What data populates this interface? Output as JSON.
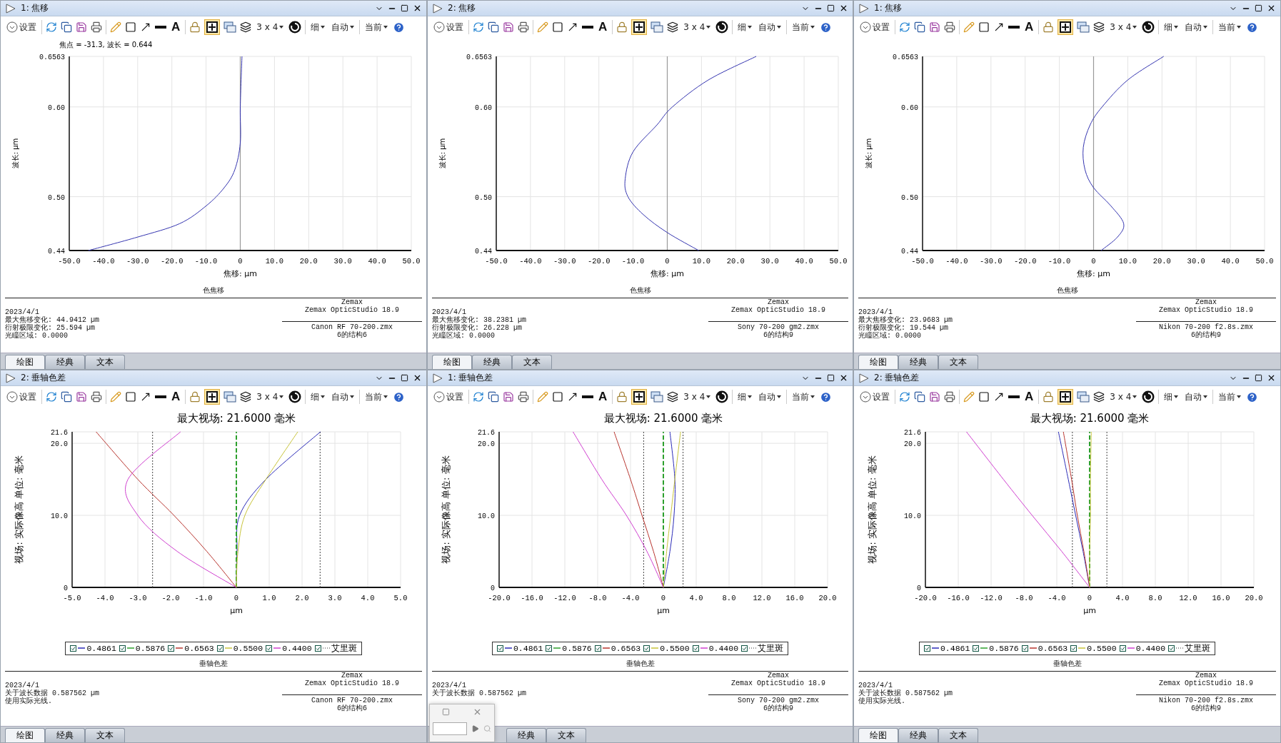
{
  "panels": [
    {
      "kind": "focal_shift",
      "title": "1: 焦移",
      "toolbar": {
        "settings": "设置",
        "text_tool": "A",
        "grid": "3 x 4",
        "line_width": "细",
        "scale": "自动",
        "config": "当前",
        "tile_view_on": true
      },
      "chart_data": {
        "type": "line",
        "orientation": "horizontal",
        "xlabel": "焦移: µm",
        "ylabel": "波长: µm",
        "x": [
          0.44,
          0.455,
          0.47,
          0.49,
          0.51,
          0.53,
          0.56,
          0.6,
          0.6563
        ],
        "grid": true,
        "series": [
          {
            "color": "#3434b0",
            "values": [
              -44.4,
              -30,
              -17.7,
              -9.9,
              -4.7,
              -1.6,
              0,
              0,
              0.5
            ]
          }
        ],
        "xlim": [
          -50,
          50
        ],
        "ylim": [
          0.44,
          0.6563
        ],
        "xticks": [
          {
            "value": -50,
            "label": "-50.0"
          },
          {
            "value": -40,
            "label": "-40.0"
          },
          {
            "value": -30,
            "label": "-30.0"
          },
          {
            "value": -20,
            "label": "-20.0"
          },
          {
            "value": -10,
            "label": "-10.0"
          },
          {
            "value": 0,
            "label": "0"
          },
          {
            "value": 10,
            "label": "10.0"
          },
          {
            "value": 20,
            "label": "20.0"
          },
          {
            "value": 30,
            "label": "30.0"
          },
          {
            "value": 40,
            "label": "40.0"
          },
          {
            "value": 50,
            "label": "50.0"
          }
        ],
        "yticks": [
          {
            "value": 0.44,
            "label": "0.44"
          },
          {
            "value": 0.5,
            "label": "0.50"
          },
          {
            "value": 0.6,
            "label": "0.60"
          },
          {
            "value": 0.6563,
            "label": "0.6563"
          }
        ],
        "annotations": [
          {
            "text": "焦点 = -31.3, 波长 = 0.644"
          }
        ]
      },
      "footer": {
        "title": "色焦移",
        "info": [
          "2023/4/1",
          "最大焦移变化: 44.9412 µm",
          "衍射极限变化: 25.594 µm",
          "光瞳区域: 0.0000"
        ],
        "vendor": "Zemax",
        "version": "Zemax OpticStudio 18.9",
        "file": "Canon RF 70-200.zmx",
        "config": "6的结构6"
      },
      "tabs": [
        {
          "label": "绘图",
          "selected": true
        },
        {
          "label": "经典",
          "selected": false
        },
        {
          "label": "文本",
          "selected": false
        }
      ]
    },
    {
      "kind": "focal_shift",
      "title": "2: 焦移",
      "toolbar": {
        "settings": "设置",
        "text_tool": "A",
        "grid": "3 x 4",
        "line_width": "细",
        "scale": "自动",
        "config": "当前",
        "tile_view_on": true
      },
      "chart_data": {
        "type": "line",
        "orientation": "horizontal",
        "xlabel": "焦移: µm",
        "ylabel": "波长: µm",
        "x": [
          0.44,
          0.46,
          0.48,
          0.5,
          0.52,
          0.55,
          0.58,
          0.6,
          0.63,
          0.6563
        ],
        "grid": true,
        "series": [
          {
            "color": "#3434b0",
            "values": [
              9.2,
              0,
              -7,
              -11.5,
              -12.3,
              -10,
              -3,
              1.5,
              12,
              26
            ]
          }
        ],
        "xlim": [
          -50,
          50
        ],
        "ylim": [
          0.44,
          0.6563
        ],
        "xticks": [
          {
            "value": -50,
            "label": "-50.0"
          },
          {
            "value": -40,
            "label": "-40.0"
          },
          {
            "value": -30,
            "label": "-30.0"
          },
          {
            "value": -20,
            "label": "-20.0"
          },
          {
            "value": -10,
            "label": "-10.0"
          },
          {
            "value": 0,
            "label": "0"
          },
          {
            "value": 10,
            "label": "10.0"
          },
          {
            "value": 20,
            "label": "20.0"
          },
          {
            "value": 30,
            "label": "30.0"
          },
          {
            "value": 40,
            "label": "40.0"
          },
          {
            "value": 50,
            "label": "50.0"
          }
        ],
        "yticks": [
          {
            "value": 0.44,
            "label": "0.44"
          },
          {
            "value": 0.5,
            "label": "0.50"
          },
          {
            "value": 0.6,
            "label": "0.60"
          },
          {
            "value": 0.6563,
            "label": "0.6563"
          }
        ]
      },
      "footer": {
        "title": "色焦移",
        "info": [
          "2023/4/1",
          "最大焦移变化: 38.2381 µm",
          "衍射极限变化: 26.228 µm",
          "光瞳区域: 0.0000"
        ],
        "vendor": "Zemax",
        "version": "Zemax OpticStudio 18.9",
        "file": "Sony 70-200 gm2.zmx",
        "config": "6的结构9"
      },
      "tabs": [
        {
          "label": "绘图",
          "selected": true
        },
        {
          "label": "经典",
          "selected": false
        },
        {
          "label": "文本",
          "selected": false
        }
      ]
    },
    {
      "kind": "focal_shift",
      "title": "1: 焦移",
      "toolbar": {
        "settings": "设置",
        "text_tool": "A",
        "grid": "3 x 4",
        "line_width": "细",
        "scale": "自动",
        "config": "当前",
        "tile_view_on": true
      },
      "chart_data": {
        "type": "line",
        "orientation": "horizontal",
        "xlabel": "焦移: µm",
        "ylabel": "波长: µm",
        "x": [
          0.44,
          0.455,
          0.47,
          0.49,
          0.51,
          0.53,
          0.555,
          0.58,
          0.6,
          0.63,
          0.6563
        ],
        "grid": true,
        "series": [
          {
            "color": "#3434b0",
            "values": [
              2.2,
              7,
              8.8,
              5,
              0,
              -2.5,
              -3,
              -1,
              2.5,
              10,
              20.5
            ]
          }
        ],
        "xlim": [
          -50,
          50
        ],
        "ylim": [
          0.44,
          0.6563
        ],
        "xticks": [
          {
            "value": -50,
            "label": "-50.0"
          },
          {
            "value": -40,
            "label": "-40.0"
          },
          {
            "value": -30,
            "label": "-30.0"
          },
          {
            "value": -20,
            "label": "-20.0"
          },
          {
            "value": -10,
            "label": "-10.0"
          },
          {
            "value": 0,
            "label": "0"
          },
          {
            "value": 10,
            "label": "10.0"
          },
          {
            "value": 20,
            "label": "20.0"
          },
          {
            "value": 30,
            "label": "30.0"
          },
          {
            "value": 40,
            "label": "40.0"
          },
          {
            "value": 50,
            "label": "50.0"
          }
        ],
        "yticks": [
          {
            "value": 0.44,
            "label": "0.44"
          },
          {
            "value": 0.5,
            "label": "0.50"
          },
          {
            "value": 0.6,
            "label": "0.60"
          },
          {
            "value": 0.6563,
            "label": "0.6563"
          }
        ]
      },
      "footer": {
        "title": "色焦移",
        "info": [
          "2023/4/1",
          "最大焦移变化: 23.9683 µm",
          "衍射极限变化: 19.544 µm",
          "光瞳区域: 0.0000"
        ],
        "vendor": "Zemax",
        "version": "Zemax OpticStudio 18.9",
        "file": "Nikon 70-200 f2.8s.zmx",
        "config": "6的结构9"
      },
      "tabs": [
        {
          "label": "绘图",
          "selected": true
        },
        {
          "label": "经典",
          "selected": false
        },
        {
          "label": "文本",
          "selected": false
        }
      ]
    },
    {
      "kind": "lateral_color",
      "title": "2: 垂轴色差",
      "toolbar": {
        "settings": "设置",
        "text_tool": "A",
        "grid": "3 x 4",
        "line_width": "细",
        "scale": "自动",
        "config": "当前",
        "tile_view_on": true
      },
      "chart_data": {
        "type": "line",
        "orientation": "horizontal",
        "title": "最大视场: 21.6000 毫米",
        "xlabel": "µm",
        "ylabel": "视场: 实际像高 单位: 毫米",
        "x": [
          0,
          5,
          10,
          15,
          21.6
        ],
        "grid": true,
        "series": [
          {
            "name": "0.4861",
            "color": "#2b2bb8",
            "values": [
              0,
              0.02,
              0.1,
              0.9,
              2.56
            ]
          },
          {
            "name": "0.5876",
            "color": "#2ca02c",
            "line_style": "dashed",
            "values": [
              0,
              0,
              0,
              0,
              0
            ]
          },
          {
            "name": "0.6563",
            "color": "#b8342e",
            "values": [
              0,
              -0.9,
              -1.9,
              -3,
              -4.27
            ]
          },
          {
            "name": "0.5500",
            "color": "#c8c43a",
            "values": [
              0,
              0.05,
              0.26,
              0.9,
              1.87
            ]
          },
          {
            "name": "0.4400",
            "color": "#d040d0",
            "values": [
              0,
              -1.8,
              -3,
              -3.3,
              -1.7
            ]
          }
        ],
        "xlim": [
          -5,
          5
        ],
        "ylim": [
          0,
          21.6
        ],
        "xticks": [
          {
            "value": -5,
            "label": "-5.0"
          },
          {
            "value": -4,
            "label": "-4.0"
          },
          {
            "value": -3,
            "label": "-3.0"
          },
          {
            "value": -2,
            "label": "-2.0"
          },
          {
            "value": -1,
            "label": "-1.0"
          },
          {
            "value": 0,
            "label": "0"
          },
          {
            "value": 1,
            "label": "1.0"
          },
          {
            "value": 2,
            "label": "2.0"
          },
          {
            "value": 3,
            "label": "3.0"
          },
          {
            "value": 4,
            "label": "4.0"
          },
          {
            "value": 5,
            "label": "5.0"
          }
        ],
        "yticks": [
          {
            "value": 0,
            "label": "0"
          },
          {
            "value": 10,
            "label": "10.0"
          },
          {
            "value": 20,
            "label": "20.0"
          },
          {
            "value": 21.6,
            "label": "21.6"
          }
        ],
        "ref_lines": [
          {
            "axis": "x",
            "value": -2.55,
            "label": "艾里斑"
          },
          {
            "axis": "x",
            "value": 2.55
          }
        ]
      },
      "footer": {
        "title": "垂轴色差",
        "info": [
          "2023/4/1",
          "关于波长数据 0.587562 µm",
          "使用实际光线."
        ],
        "vendor": "Zemax",
        "version": "Zemax OpticStudio 18.9",
        "file": "Canon RF 70-200.zmx",
        "config": "6的结构6"
      },
      "tabs": [
        {
          "label": "绘图",
          "selected": true
        },
        {
          "label": "经典",
          "selected": false
        },
        {
          "label": "文本",
          "selected": false
        }
      ]
    },
    {
      "kind": "lateral_color",
      "title": "1: 垂轴色差",
      "toolbar": {
        "settings": "设置",
        "text_tool": "A",
        "grid": "3 x 4",
        "line_width": "细",
        "scale": "自动",
        "config": "当前",
        "tile_view_on": true
      },
      "chart_data": {
        "type": "line",
        "orientation": "horizontal",
        "title": "最大视场: 21.6000 毫米",
        "xlabel": "µm",
        "ylabel": "视场: 实际像高 单位: 毫米",
        "x": [
          0,
          5,
          10,
          15,
          21.6
        ],
        "grid": true,
        "series": [
          {
            "name": "0.4861",
            "color": "#2b2bb8",
            "values": [
              0,
              0.8,
              1.3,
              1.4,
              0.8
            ]
          },
          {
            "name": "0.5876",
            "color": "#2ca02c",
            "line_style": "dashed",
            "values": [
              0,
              0,
              0,
              0,
              0
            ]
          },
          {
            "name": "0.6563",
            "color": "#b8342e",
            "values": [
              0,
              -1.2,
              -2.6,
              -4,
              -6
            ]
          },
          {
            "name": "0.5500",
            "color": "#c8c43a",
            "values": [
              0,
              0.4,
              0.9,
              1.4,
              2.1
            ]
          },
          {
            "name": "0.4400",
            "color": "#d040d0",
            "values": [
              0,
              -2,
              -4.5,
              -7.5,
              -11
            ]
          }
        ],
        "xlim": [
          -20,
          20
        ],
        "ylim": [
          0,
          21.6
        ],
        "xticks": [
          {
            "value": -20,
            "label": "-20.0"
          },
          {
            "value": -16,
            "label": "-16.0"
          },
          {
            "value": -12,
            "label": "-12.0"
          },
          {
            "value": -8,
            "label": "-8.0"
          },
          {
            "value": -4,
            "label": "-4.0"
          },
          {
            "value": 0,
            "label": "0"
          },
          {
            "value": 4,
            "label": "4.0"
          },
          {
            "value": 8,
            "label": "8.0"
          },
          {
            "value": 12,
            "label": "12.0"
          },
          {
            "value": 16,
            "label": "16.0"
          },
          {
            "value": 20,
            "label": "20.0"
          }
        ],
        "yticks": [
          {
            "value": 0,
            "label": "0"
          },
          {
            "value": 10,
            "label": "10.0"
          },
          {
            "value": 20,
            "label": "20.0"
          },
          {
            "value": 21.6,
            "label": "21.6"
          }
        ],
        "ref_lines": [
          {
            "axis": "x",
            "value": -2.4,
            "label": "艾里斑"
          },
          {
            "axis": "x",
            "value": 2.4
          }
        ]
      },
      "footer": {
        "title": "垂轴色差",
        "info": [
          "2023/4/1",
          "关于波长数据 0.587562 µm"
        ],
        "vendor": "Zemax",
        "version": "Zemax OpticStudio 18.9",
        "file": "Sony 70-200 gm2.zmx",
        "config": "6的结构9"
      },
      "popup": {
        "kind": "mini_window"
      },
      "tabs": [
        {
          "label": "经典",
          "selected": false
        },
        {
          "label": "文本",
          "selected": false
        }
      ]
    },
    {
      "kind": "lateral_color",
      "title": "2: 垂轴色差",
      "toolbar": {
        "settings": "设置",
        "text_tool": "A",
        "grid": "3 x 4",
        "line_width": "细",
        "scale": "自动",
        "config": "当前",
        "tile_view_on": true
      },
      "chart_data": {
        "type": "line",
        "orientation": "horizontal",
        "title": "最大视场: 21.6000 毫米",
        "xlabel": "µm",
        "ylabel": "视场: 实际像高 单位: 毫米",
        "x": [
          0,
          5,
          10,
          15,
          21.6
        ],
        "grid": true,
        "series": [
          {
            "name": "0.4861",
            "color": "#2b2bb8",
            "values": [
              0,
              -0.8,
              -1.7,
              -2.6,
              -3.8
            ]
          },
          {
            "name": "0.5876",
            "color": "#2ca02c",
            "line_style": "dashed",
            "values": [
              0,
              0,
              0,
              0,
              0
            ]
          },
          {
            "name": "0.6563",
            "color": "#b8342e",
            "values": [
              0,
              -0.7,
              -1.5,
              -2.2,
              -3.2
            ]
          },
          {
            "name": "0.5500",
            "color": "#c8c43a",
            "values": [
              0,
              0,
              0.1,
              0.1,
              0.2
            ]
          },
          {
            "name": "0.4400",
            "color": "#d040d0",
            "values": [
              0,
              -3.4,
              -7,
              -10.5,
              -15
            ]
          }
        ],
        "xlim": [
          -20,
          20
        ],
        "ylim": [
          0,
          21.6
        ],
        "xticks": [
          {
            "value": -20,
            "label": "-20.0"
          },
          {
            "value": -16,
            "label": "-16.0"
          },
          {
            "value": -12,
            "label": "-12.0"
          },
          {
            "value": -8,
            "label": "-8.0"
          },
          {
            "value": -4,
            "label": "-4.0"
          },
          {
            "value": 0,
            "label": "0"
          },
          {
            "value": 4,
            "label": "4.0"
          },
          {
            "value": 8,
            "label": "8.0"
          },
          {
            "value": 12,
            "label": "12.0"
          },
          {
            "value": 16,
            "label": "16.0"
          },
          {
            "value": 20,
            "label": "20.0"
          }
        ],
        "yticks": [
          {
            "value": 0,
            "label": "0"
          },
          {
            "value": 10,
            "label": "10.0"
          },
          {
            "value": 20,
            "label": "20.0"
          },
          {
            "value": 21.6,
            "label": "21.6"
          }
        ],
        "ref_lines": [
          {
            "axis": "x",
            "value": -2.1,
            "label": "艾里斑"
          },
          {
            "axis": "x",
            "value": 2.1
          }
        ]
      },
      "footer": {
        "title": "垂轴色差",
        "info": [
          "2023/4/1",
          "关于波长数据 0.587562 µm",
          "使用实际光线."
        ],
        "vendor": "Zemax",
        "version": "Zemax OpticStudio 18.9",
        "file": "Nikon 70-200 f2.8s.zmx",
        "config": "6的结构9"
      },
      "tabs": [
        {
          "label": "绘图",
          "selected": true
        },
        {
          "label": "经典",
          "selected": false
        },
        {
          "label": "文本",
          "selected": false
        }
      ]
    }
  ]
}
